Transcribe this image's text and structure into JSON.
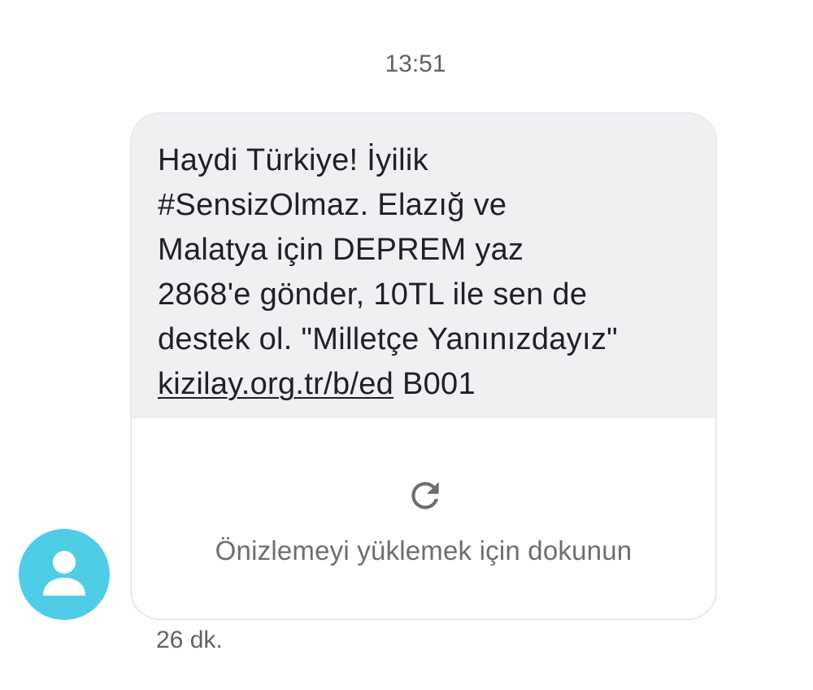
{
  "conversation": {
    "timestamp": "13:51",
    "message": {
      "lines": [
        "Haydi Türkiye! İyilik",
        "#SensizOlmaz. Elazığ ve",
        "Malatya için DEPREM yaz",
        "2868'e gönder, 10TL ile sen de",
        "destek ol. \"Milletçe Yanınızdayız\""
      ],
      "link_text": "kizilay.org.tr/b/ed",
      "link_suffix": " B001",
      "bubble_color": "#eef0f2"
    },
    "preview": {
      "icon": "refresh-icon",
      "label": "Önizlemeyi yüklemek için dokunun"
    },
    "sender_avatar": {
      "icon": "person-icon",
      "color": "#4fcde6"
    },
    "time_ago": "26 dk."
  }
}
